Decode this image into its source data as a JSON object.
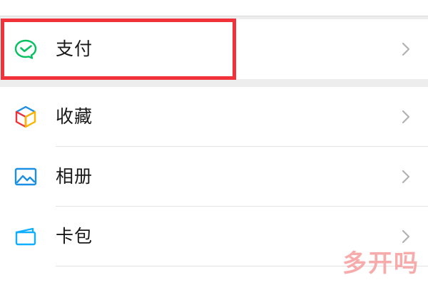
{
  "menu": {
    "items": [
      {
        "label": "支付",
        "icon": "wechat-pay-icon"
      },
      {
        "label": "收藏",
        "icon": "favorites-cube-icon"
      },
      {
        "label": "相册",
        "icon": "album-picture-icon"
      },
      {
        "label": "卡包",
        "icon": "card-wallet-icon"
      }
    ]
  },
  "highlight": {
    "target": "支付",
    "color": "#f2323a"
  },
  "watermark": {
    "text": "多开吗"
  },
  "colors": {
    "background": "#ededed",
    "row_background": "#ffffff",
    "label": "#191919",
    "chevron": "#b2b2b2",
    "pay_green": "#07c160",
    "album_blue": "#1a8fe3",
    "card_teal": "#10aeff"
  }
}
